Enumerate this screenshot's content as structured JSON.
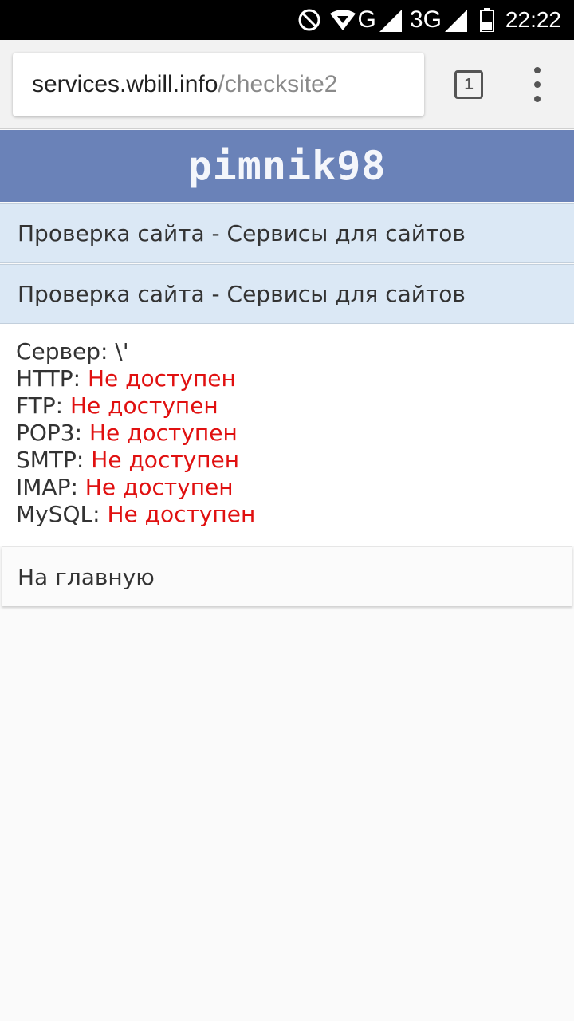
{
  "status_bar": {
    "network_type_1": "G",
    "network_type_2": "3G",
    "time": "22:22",
    "icons": [
      "do-not-disturb-icon",
      "wifi-icon",
      "signal-icon",
      "signal-icon",
      "battery-icon"
    ]
  },
  "browser": {
    "url_host": "services.wbill.info",
    "url_path": "/checksite2",
    "tab_count": "1",
    "menu_icon": "more-vert-icon"
  },
  "site": {
    "logo": "pimnik98",
    "breadcrumb": "Проверка сайта - Сервисы для сайтов",
    "page_title": "Проверка сайта - Сервисы для сайтов"
  },
  "results": {
    "server_label": "Сервер:",
    "server_value": "\\'",
    "rows": [
      {
        "label": "HTTP:",
        "status": "Не доступен"
      },
      {
        "label": "FTP:",
        "status": "Не доступен"
      },
      {
        "label": "POP3:",
        "status": "Не доступен"
      },
      {
        "label": "SMTP:",
        "status": "Не доступен"
      },
      {
        "label": "IMAP:",
        "status": "Не доступен"
      },
      {
        "label": "MySQL:",
        "status": "Не доступен"
      }
    ]
  },
  "nav": {
    "home_label": "На главную"
  },
  "colors": {
    "header_bg": "#6a82b8",
    "title_bg": "#dbe8f5",
    "status_error": "#e01010"
  }
}
